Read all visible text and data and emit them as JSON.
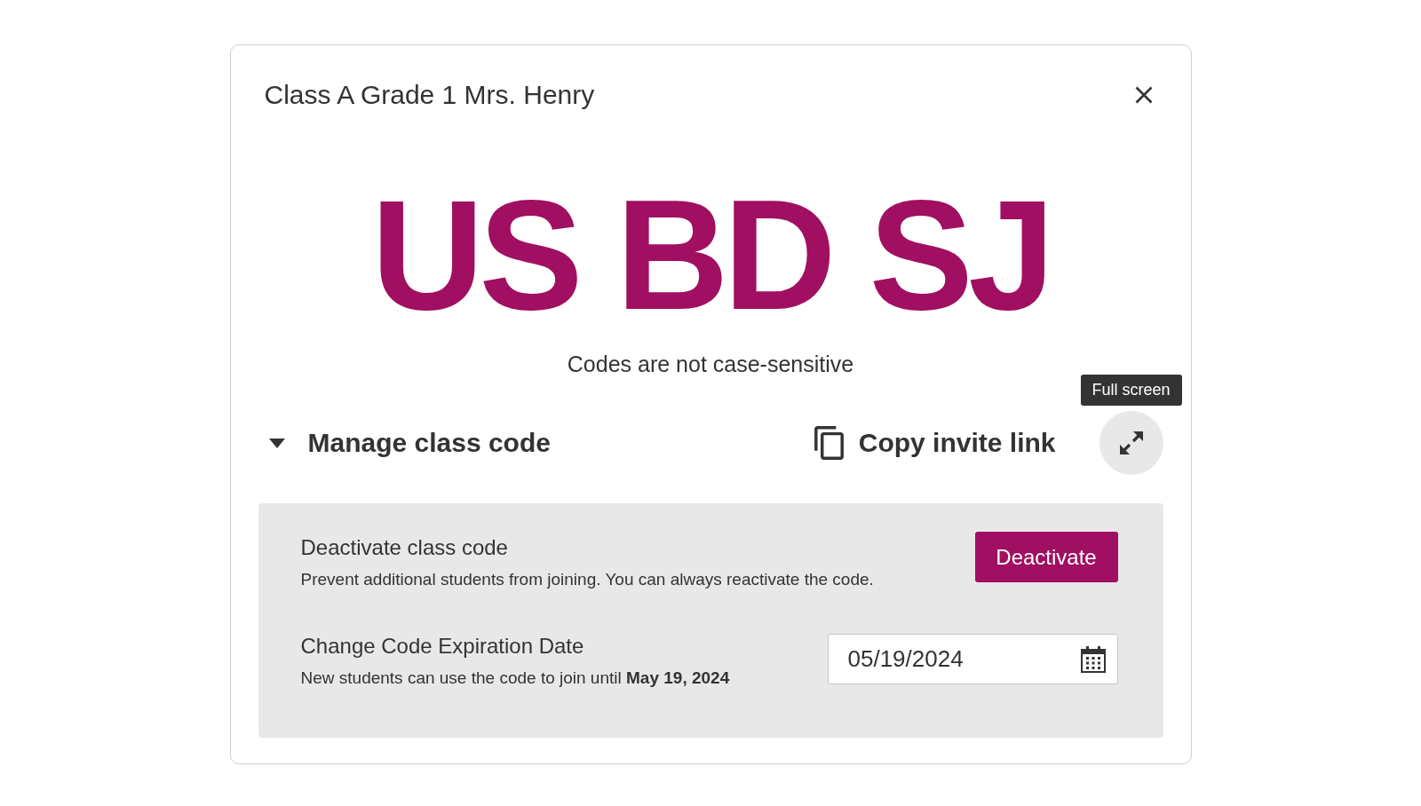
{
  "dialog": {
    "title": "Class A Grade 1 Mrs. Henry",
    "class_code": "US BD SJ",
    "code_note": "Codes are not case-sensitive"
  },
  "manage": {
    "label": "Manage class code",
    "expanded": true
  },
  "copy_link": {
    "label": "Copy invite link"
  },
  "fullscreen": {
    "tooltip": "Full screen"
  },
  "settings": [
    {
      "kind": "button",
      "title": "Deactivate class code",
      "description": "Prevent additional students from joining. You can always reactivate the code.",
      "button": "Deactivate"
    },
    {
      "kind": "date",
      "title": "Change Code Expiration Date",
      "description": "New students can use the code to join until **May 19, 2024**",
      "value": "05/19/2024"
    }
  ]
}
